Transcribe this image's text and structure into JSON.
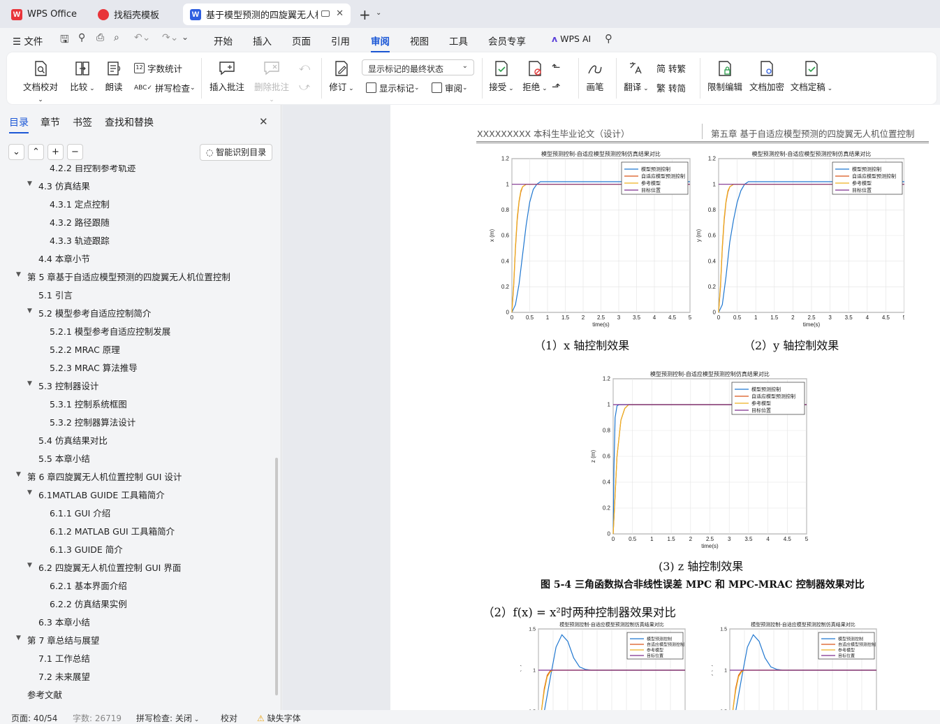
{
  "tabs": [
    {
      "label": "WPS Office",
      "logo": "W",
      "color": "#e8343a"
    },
    {
      "label": "找稻壳模板",
      "logo": "",
      "color": "#e8343a"
    },
    {
      "label": "基于模型预测的四旋翼无人机位",
      "logo": "W",
      "color": "#2f5fe0"
    }
  ],
  "menu": {
    "file": "文件",
    "items": [
      "开始",
      "插入",
      "页面",
      "引用",
      "审阅",
      "视图",
      "工具",
      "会员专享"
    ],
    "active": "审阅",
    "ai": "WPS AI"
  },
  "ribbon": {
    "doc_check": "文档校对",
    "compare": "比较",
    "read": "朗读",
    "word_count": "字数统计",
    "spell_check": "拼写检查",
    "insert_comment": "插入批注",
    "delete_comment": "删除批注",
    "track": "修订",
    "display_state": "显示标记的最终状态",
    "show_marks": "显示标记",
    "review": "审阅",
    "accept": "接受",
    "reject": "拒绝",
    "pen": "画笔",
    "translate": "翻译",
    "to_trad": "转繁",
    "to_simp": "转简",
    "restrict": "限制编辑",
    "encrypt": "文档加密",
    "finalize": "文档定稿"
  },
  "sidebar": {
    "tabs": [
      "目录",
      "章节",
      "书签",
      "查找和替换"
    ],
    "ai_toc": "智能识别目录",
    "toc": [
      {
        "label": "4.2.2 自控制参考轨迹",
        "level": 3,
        "tri": false
      },
      {
        "label": "4.3 仿真结果",
        "level": 2,
        "tri": true
      },
      {
        "label": "4.3.1 定点控制",
        "level": 3,
        "tri": false
      },
      {
        "label": "4.3.2 路径跟随",
        "level": 3,
        "tri": false
      },
      {
        "label": "4.3.3 轨迹跟踪",
        "level": 3,
        "tri": false
      },
      {
        "label": "4.4 本章小节",
        "level": 2,
        "tri": false
      },
      {
        "label": "第 5 章基于自适应模型预测的四旋翼无人机位置控制",
        "level": 1,
        "tri": true
      },
      {
        "label": "5.1 引言",
        "level": 2,
        "tri": false
      },
      {
        "label": "5.2 模型参考自适应控制简介",
        "level": 2,
        "tri": true
      },
      {
        "label": "5.2.1 模型参考自适应控制发展",
        "level": 3,
        "tri": false
      },
      {
        "label": "5.2.2 MRAC 原理",
        "level": 3,
        "tri": false
      },
      {
        "label": "5.2.3 MRAC 算法推导",
        "level": 3,
        "tri": false
      },
      {
        "label": "5.3 控制器设计",
        "level": 2,
        "tri": true
      },
      {
        "label": "5.3.1 控制系统框图",
        "level": 3,
        "tri": false
      },
      {
        "label": "5.3.2 控制器算法设计",
        "level": 3,
        "tri": false
      },
      {
        "label": "5.4 仿真结果对比",
        "level": 2,
        "tri": false
      },
      {
        "label": "5.5  本章小结",
        "level": 2,
        "tri": false
      },
      {
        "label": "第 6 章四旋翼无人机位置控制 GUI 设计",
        "level": 1,
        "tri": true
      },
      {
        "label": "6.1MATLAB GUIDE 工具箱简介",
        "level": 2,
        "tri": true
      },
      {
        "label": "6.1.1 GUI 介绍",
        "level": 3,
        "tri": false
      },
      {
        "label": "6.1.2 MATLAB GUI 工具箱简介",
        "level": 3,
        "tri": false
      },
      {
        "label": "6.1.3 GUIDE 简介",
        "level": 3,
        "tri": false
      },
      {
        "label": "6.2 四旋翼无人机位置控制 GUI 界面",
        "level": 2,
        "tri": true
      },
      {
        "label": "6.2.1  基本界面介绍",
        "level": 3,
        "tri": false
      },
      {
        "label": "6.2.2  仿真结果实例",
        "level": 3,
        "tri": false
      },
      {
        "label": "6.3  本章小结",
        "level": 2,
        "tri": false
      },
      {
        "label": "第 7 章总结与展望",
        "level": 1,
        "tri": true
      },
      {
        "label": "7.1 工作总结",
        "level": 2,
        "tri": false
      },
      {
        "label": "7.2 未来展望",
        "level": 2,
        "tri": false
      },
      {
        "label": "参考文献",
        "level": 1,
        "tri": false
      }
    ]
  },
  "doc": {
    "header_left": "XXXXXXXXX 本科生毕业论文（设计）",
    "header_right": "第五章  基于自适应模型预测的四旋翼无人机位置控制",
    "cap_x": "（1）x 轴控制效果",
    "cap_y": "（2）y 轴控制效果",
    "cap_z": "(3) z 轴控制效果",
    "fig_caption": "图 5-4 三角函数拟合非线性误差 MPC 和 MPC-MRAC 控制器效果对比",
    "section_line": "（2）f(x) = x²时两种控制器效果对比"
  },
  "chart_data": [
    {
      "type": "line",
      "title": "模型预测控制-自适应模型预测控制仿真结果对比",
      "xlabel": "time(s)",
      "ylabel": "x (m)",
      "xlim": [
        0,
        5
      ],
      "ylim": [
        0,
        1.2
      ],
      "grid": true,
      "legend": "top-right",
      "series": [
        {
          "name": "模型预测控制",
          "color": "#1f77d0",
          "x": [
            0,
            0.1,
            0.2,
            0.3,
            0.4,
            0.5,
            0.6,
            0.7,
            0.8,
            1.0,
            1.5,
            5
          ],
          "values": [
            0,
            0.06,
            0.22,
            0.45,
            0.68,
            0.86,
            0.96,
            1.0,
            1.02,
            1.02,
            1.02,
            1.02
          ]
        },
        {
          "name": "自适应模型预测控制",
          "color": "#d95319",
          "x": [
            0,
            0.05,
            0.1,
            0.15,
            0.2,
            0.25,
            0.3,
            0.4,
            0.5,
            5
          ],
          "values": [
            0,
            0.2,
            0.5,
            0.72,
            0.86,
            0.94,
            0.98,
            1.0,
            1.0,
            1.0
          ]
        },
        {
          "name": "参考模型",
          "color": "#edb120",
          "x": [
            0,
            0.05,
            0.1,
            0.15,
            0.2,
            0.25,
            0.3,
            0.4,
            0.5,
            5
          ],
          "values": [
            0,
            0.22,
            0.52,
            0.74,
            0.87,
            0.95,
            0.98,
            1.0,
            1.0,
            1.0
          ]
        },
        {
          "name": "目标位置",
          "color": "#7e2f8e",
          "x": [
            0,
            5
          ],
          "values": [
            1,
            1
          ]
        }
      ]
    },
    {
      "type": "line",
      "title": "模型预测控制-自适应模型预测控制仿真结果对比",
      "xlabel": "time(s)",
      "ylabel": "y (m)",
      "xlim": [
        0,
        5
      ],
      "ylim": [
        0,
        1.2
      ],
      "grid": true,
      "legend": "top-right",
      "series": [
        {
          "name": "模型预测控制",
          "color": "#1f77d0",
          "x": [
            0,
            0.1,
            0.2,
            0.3,
            0.4,
            0.5,
            0.6,
            0.7,
            0.8,
            1.0,
            1.5,
            5
          ],
          "values": [
            0,
            0.06,
            0.28,
            0.55,
            0.72,
            0.86,
            0.95,
            1.0,
            1.02,
            1.02,
            1.02,
            1.02
          ]
        },
        {
          "name": "自适应模型预测控制",
          "color": "#d95319",
          "x": [
            0,
            0.05,
            0.1,
            0.15,
            0.2,
            0.25,
            0.3,
            0.4,
            0.5,
            5
          ],
          "values": [
            0,
            0.2,
            0.5,
            0.72,
            0.86,
            0.94,
            0.98,
            1.0,
            1.0,
            1.0
          ]
        },
        {
          "name": "参考模型",
          "color": "#edb120",
          "x": [
            0,
            0.05,
            0.1,
            0.15,
            0.2,
            0.25,
            0.3,
            0.4,
            0.5,
            5
          ],
          "values": [
            0,
            0.22,
            0.52,
            0.74,
            0.87,
            0.95,
            0.98,
            1.0,
            1.0,
            1.0
          ]
        },
        {
          "name": "目标位置",
          "color": "#7e2f8e",
          "x": [
            0,
            5
          ],
          "values": [
            1,
            1
          ]
        }
      ]
    },
    {
      "type": "line",
      "title": "模型预测控制-自适应模型预测控制仿真结果对比",
      "xlabel": "time(s)",
      "ylabel": "z (m)",
      "xlim": [
        0,
        5
      ],
      "ylim": [
        0,
        1.2
      ],
      "grid": true,
      "legend": "top-right",
      "series": [
        {
          "name": "模型预测控制",
          "color": "#1f77d0",
          "x": [
            0,
            0.02,
            0.05,
            0.1,
            0.15,
            0.2,
            0.3,
            5
          ],
          "values": [
            0,
            0.5,
            0.9,
            0.99,
            1.0,
            1.0,
            1.0,
            1.0
          ]
        },
        {
          "name": "自适应模型预测控制",
          "color": "#d95319",
          "x": [
            0,
            0.05,
            0.1,
            0.2,
            0.3,
            0.4,
            0.5,
            5
          ],
          "values": [
            0,
            0.3,
            0.6,
            0.88,
            0.97,
            1.0,
            1.0,
            1.0
          ]
        },
        {
          "name": "参考模型",
          "color": "#edb120",
          "x": [
            0,
            0.05,
            0.1,
            0.2,
            0.3,
            0.4,
            0.5,
            5
          ],
          "values": [
            0,
            0.3,
            0.6,
            0.88,
            0.97,
            1.0,
            1.0,
            1.0
          ]
        },
        {
          "name": "目标位置",
          "color": "#7e2f8e",
          "x": [
            0,
            5
          ],
          "values": [
            1,
            1
          ]
        }
      ]
    },
    {
      "type": "line",
      "title": "模型预测控制-自适应模型预测控制仿真结果对比",
      "xlabel": "",
      "ylabel": "x (m)",
      "xlim": [
        0,
        5
      ],
      "ylim": [
        0.5,
        1.5
      ],
      "grid": true,
      "legend": "top-right",
      "series": [
        {
          "name": "模型预测控制",
          "color": "#1f77d0",
          "x": [
            0,
            0.2,
            0.4,
            0.6,
            0.8,
            1.0,
            1.2,
            1.4,
            1.6,
            1.8,
            2.0,
            2.5,
            5
          ],
          "values": [
            0,
            0.4,
            0.9,
            1.28,
            1.43,
            1.35,
            1.15,
            1.04,
            1.01,
            1.0,
            1.0,
            1.0,
            1.0
          ]
        },
        {
          "name": "自适应模型预测控制",
          "color": "#d95319",
          "x": [
            0,
            0.1,
            0.2,
            0.3,
            0.4,
            0.5,
            0.6,
            5
          ],
          "values": [
            0,
            0.45,
            0.78,
            0.94,
            0.99,
            1.0,
            1.0,
            1.0
          ]
        },
        {
          "name": "参考模型",
          "color": "#edb120",
          "x": [
            0,
            0.1,
            0.2,
            0.3,
            0.4,
            0.5,
            0.6,
            5
          ],
          "values": [
            0,
            0.42,
            0.75,
            0.92,
            0.98,
            1.0,
            1.0,
            1.0
          ]
        },
        {
          "name": "目标位置",
          "color": "#7e2f8e",
          "x": [
            0,
            5
          ],
          "values": [
            1,
            1
          ]
        }
      ]
    },
    {
      "type": "line",
      "title": "模型预测控制-自适应模型预测控制仿真结果对比",
      "xlabel": "",
      "ylabel": "y (m)",
      "xlim": [
        0,
        5
      ],
      "ylim": [
        0.5,
        1.5
      ],
      "grid": true,
      "legend": "top-right",
      "series": [
        {
          "name": "模型预测控制",
          "color": "#1f77d0",
          "x": [
            0,
            0.2,
            0.4,
            0.6,
            0.8,
            1.0,
            1.2,
            1.4,
            1.6,
            1.8,
            2.0,
            2.5,
            5
          ],
          "values": [
            0,
            0.4,
            0.9,
            1.28,
            1.43,
            1.35,
            1.15,
            1.04,
            1.01,
            1.0,
            1.0,
            1.0,
            1.0
          ]
        },
        {
          "name": "自适应模型预测控制",
          "color": "#d95319",
          "x": [
            0,
            0.1,
            0.2,
            0.3,
            0.4,
            0.5,
            0.6,
            5
          ],
          "values": [
            0,
            0.45,
            0.78,
            0.94,
            0.99,
            1.0,
            1.0,
            1.0
          ]
        },
        {
          "name": "参考模型",
          "color": "#edb120",
          "x": [
            0,
            0.1,
            0.2,
            0.3,
            0.4,
            0.5,
            0.6,
            5
          ],
          "values": [
            0,
            0.42,
            0.75,
            0.92,
            0.98,
            1.0,
            1.0,
            1.0
          ]
        },
        {
          "name": "目标位置",
          "color": "#7e2f8e",
          "x": [
            0,
            5
          ],
          "values": [
            1,
            1
          ]
        }
      ]
    }
  ],
  "status": {
    "page": "页面: 40/54",
    "words": "字数: 26719",
    "spell": "拼写检查: 关闭",
    "proof": "校对",
    "missing_font": "缺失字体"
  }
}
